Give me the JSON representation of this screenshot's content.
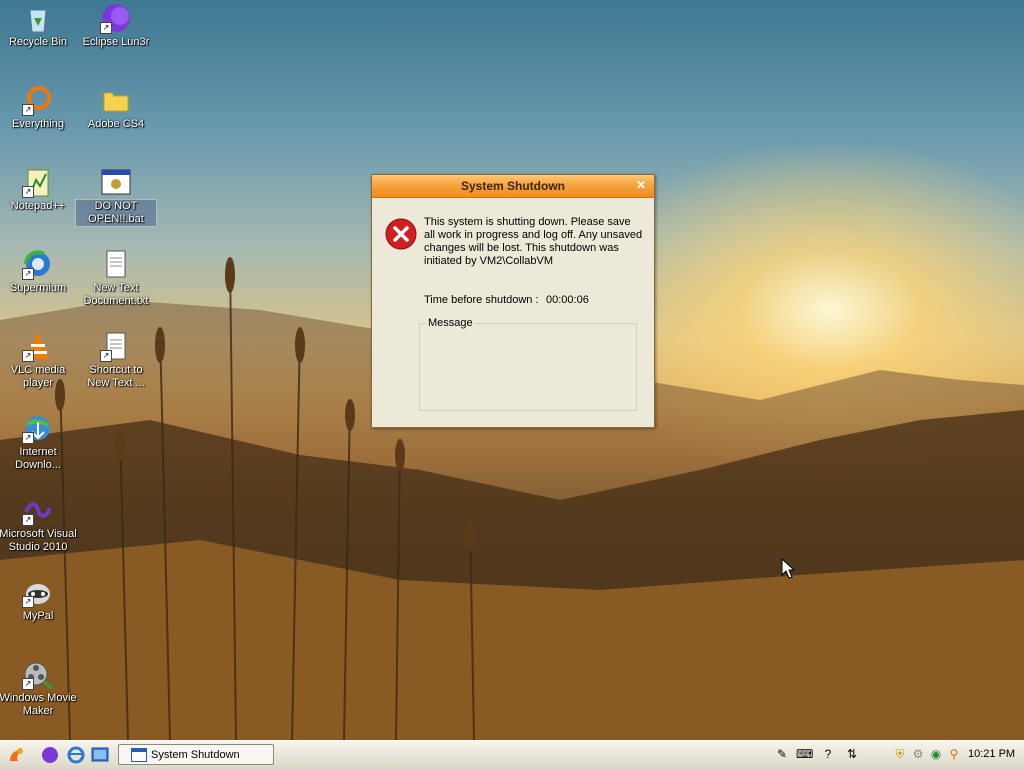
{
  "desktop": {
    "icons": [
      {
        "label": "Recycle Bin"
      },
      {
        "label": "Eclipse Lun3r"
      },
      {
        "label": "Everything"
      },
      {
        "label": "Adobe CS4"
      },
      {
        "label": "Notepad++"
      },
      {
        "label": "DO NOT OPEN!!.bat"
      },
      {
        "label": "Supermium"
      },
      {
        "label": "New Text Document.txt"
      },
      {
        "label": "VLC media player"
      },
      {
        "label": "Shortcut to New Text ..."
      },
      {
        "label": "Internet Downlo..."
      },
      {
        "label": "Microsoft Visual Studio 2010"
      },
      {
        "label": "MyPal"
      },
      {
        "label": "Windows Movie Maker"
      }
    ]
  },
  "dialog": {
    "title": "System Shutdown",
    "message": "This system is shutting down. Please save all work in progress and log off. Any unsaved changes will be lost. This shutdown was initiated by VM2\\CollabVM",
    "time_label": "Time before shutdown :",
    "time_value": "00:00:06",
    "message_group_label": "Message",
    "close_glyph": "✕"
  },
  "taskbar": {
    "task_label": "System Shutdown",
    "clock": "10:21 PM"
  },
  "colors": {
    "title_bar": "#f5a13c",
    "dialog_bg": "#ece9d8",
    "error_red": "#d21f1f"
  }
}
